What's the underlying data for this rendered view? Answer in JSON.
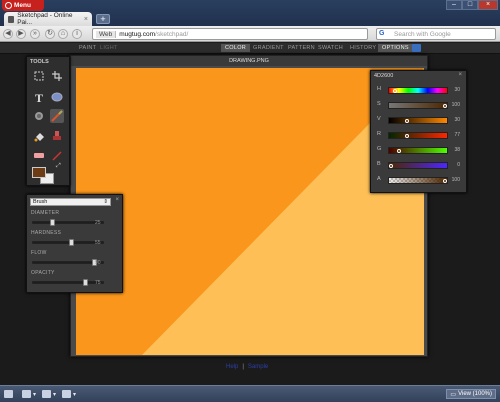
{
  "browser": {
    "menu_label": "Menu",
    "tab_title": "Sketchpad - Online Pai...",
    "address_prefix": "Web",
    "address_domain": "mugtug.com",
    "address_path": "/sketchpad/",
    "search_placeholder": "Search with Google"
  },
  "appbar": {
    "left_items": [
      "PAINT",
      "LIGHT"
    ],
    "right_items": [
      "COLOR",
      "GRADIENT",
      "PATTERN",
      "SWATCH",
      "HISTORY",
      "OPTIONS"
    ],
    "active": "COLOR"
  },
  "tools": {
    "title": "TOOLS",
    "items": [
      "marquee",
      "crop",
      "text",
      "shape",
      "fill",
      "brush",
      "bucket",
      "stamp",
      "eraser",
      "picker"
    ],
    "foreground_color": "#6e3c14",
    "background_color": "#eeeeee"
  },
  "canvas": {
    "title": "DRAWING.PNG",
    "color_dark": "#fa961b",
    "color_light": "#fdbf56"
  },
  "brush": {
    "selected": "Brush",
    "params": [
      {
        "label": "DIAMETER",
        "value": "25",
        "fraction": 0.25
      },
      {
        "label": "HARDNESS",
        "value": "55",
        "fraction": 0.55
      },
      {
        "label": "FLOW",
        "value": "90",
        "fraction": 0.9
      },
      {
        "label": "OPACITY",
        "value": "75",
        "fraction": 0.75
      }
    ]
  },
  "color_panel": {
    "hex": "4D2600",
    "rows": [
      {
        "label": "H",
        "value": "30",
        "gradient": "linear-gradient(90deg,#f00,#ff0,#0f0,#0ff,#00f,#f0f,#f00)",
        "fraction": 0.08
      },
      {
        "label": "S",
        "value": "100",
        "gradient": "linear-gradient(90deg,#777,#4d2600)",
        "fraction": 1.0
      },
      {
        "label": "V",
        "value": "30",
        "gradient": "linear-gradient(90deg,#000,#f80)",
        "fraction": 0.3
      },
      {
        "label": "R",
        "value": "77",
        "gradient": "linear-gradient(90deg,#002600,#ff2600)",
        "fraction": 0.3
      },
      {
        "label": "G",
        "value": "38",
        "gradient": "linear-gradient(90deg,#4d0000,#4dff00)",
        "fraction": 0.15
      },
      {
        "label": "B",
        "value": "0",
        "gradient": "linear-gradient(90deg,#4d2600,#4d26ff)",
        "fraction": 0.0
      },
      {
        "label": "A",
        "value": "100",
        "gradient": "linear-gradient(90deg,rgba(77,38,0,0),#4d2600)",
        "fraction": 1.0
      }
    ]
  },
  "links": [
    "Help",
    "Sample"
  ],
  "status": {
    "zoom_label": "View (100%)"
  }
}
